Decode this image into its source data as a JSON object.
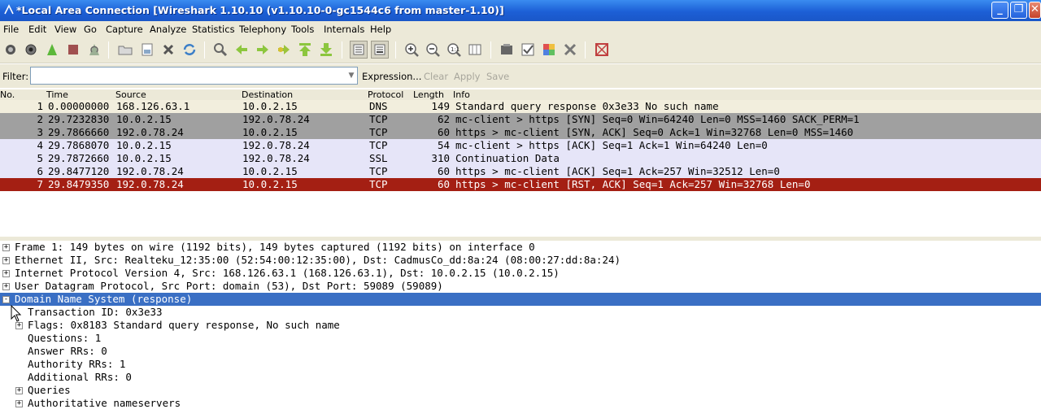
{
  "window": {
    "title": "*Local Area Connection   [Wireshark 1.10.10  (v1.10.10-0-gc1544c6 from master-1.10)]",
    "minimize_label": "_",
    "maximize_label": "❐",
    "close_label": "✕"
  },
  "menu": [
    "File",
    "Edit",
    "View",
    "Go",
    "Capture",
    "Analyze",
    "Statistics",
    "Telephony",
    "Tools",
    "Internals",
    "Help"
  ],
  "toolbar_icons": [
    "interfaces-icon",
    "options-icon",
    "start-capture-icon",
    "stop-capture-icon",
    "restart-capture-icon",
    "open-file-icon",
    "save-file-icon",
    "close-file-icon",
    "reload-icon",
    "find-packet-icon",
    "go-back-icon",
    "go-forward-icon",
    "go-to-packet-icon",
    "go-first-icon",
    "go-last-icon",
    "colorize-icon",
    "auto-scroll-icon",
    "zoom-in-icon",
    "zoom-out-icon",
    "normal-size-icon",
    "resize-columns-icon",
    "capture-filters-icon",
    "display-filters-icon",
    "coloring-rules-icon",
    "preferences-icon",
    "help-icon"
  ],
  "filter": {
    "label": "Filter:",
    "value": "",
    "expression_label": "Expression...",
    "clear_label": "Clear",
    "apply_label": "Apply",
    "save_label": "Save"
  },
  "packet_list": {
    "columns": [
      "No.",
      "Time",
      "Source",
      "Destination",
      "Protocol",
      "Length",
      "Info"
    ],
    "rows": [
      {
        "no": "1",
        "time": "0.00000000",
        "src": "168.126.63.1",
        "dst": "10.0.2.15",
        "proto": "DNS",
        "len": "149",
        "info": "Standard query response 0x3e33  No such name",
        "bg": "#f2eedd",
        "fg": "#000000"
      },
      {
        "no": "2",
        "time": "29.7232830",
        "src": "10.0.2.15",
        "dst": "192.0.78.24",
        "proto": "TCP",
        "len": "62",
        "info": "mc-client > https [SYN] Seq=0 Win=64240 Len=0 MSS=1460 SACK_PERM=1",
        "bg": "#a0a0a0",
        "fg": "#000000"
      },
      {
        "no": "3",
        "time": "29.7866660",
        "src": "192.0.78.24",
        "dst": "10.0.2.15",
        "proto": "TCP",
        "len": "60",
        "info": "https > mc-client [SYN, ACK] Seq=0 Ack=1 Win=32768 Len=0 MSS=1460",
        "bg": "#a0a0a0",
        "fg": "#000000"
      },
      {
        "no": "4",
        "time": "29.7868070",
        "src": "10.0.2.15",
        "dst": "192.0.78.24",
        "proto": "TCP",
        "len": "54",
        "info": "mc-client > https [ACK] Seq=1 Ack=1 Win=64240 Len=0",
        "bg": "#e6e5f8",
        "fg": "#000000"
      },
      {
        "no": "5",
        "time": "29.7872660",
        "src": "10.0.2.15",
        "dst": "192.0.78.24",
        "proto": "SSL",
        "len": "310",
        "info": "Continuation Data",
        "bg": "#e6e5f8",
        "fg": "#000000"
      },
      {
        "no": "6",
        "time": "29.8477120",
        "src": "192.0.78.24",
        "dst": "10.0.2.15",
        "proto": "TCP",
        "len": "60",
        "info": "https > mc-client [ACK] Seq=1 Ack=257 Win=32512 Len=0",
        "bg": "#e6e5f8",
        "fg": "#000000"
      },
      {
        "no": "7",
        "time": "29.8479350",
        "src": "192.0.78.24",
        "dst": "10.0.2.15",
        "proto": "TCP",
        "len": "60",
        "info": "https > mc-client [RST, ACK] Seq=1 Ack=257 Win=32768 Len=0",
        "bg": "#a41f13",
        "fg": "#ffffff"
      }
    ]
  },
  "details": [
    {
      "text": "Frame 1: 149 bytes on wire (1192 bits), 149 bytes captured (1192 bits) on interface 0",
      "level": 0,
      "expander": "+",
      "selected": false
    },
    {
      "text": "Ethernet II, Src: Realteku_12:35:00 (52:54:00:12:35:00), Dst: CadmusCo_dd:8a:24 (08:00:27:dd:8a:24)",
      "level": 0,
      "expander": "+",
      "selected": false
    },
    {
      "text": "Internet Protocol Version 4, Src: 168.126.63.1 (168.126.63.1), Dst: 10.0.2.15 (10.0.2.15)",
      "level": 0,
      "expander": "+",
      "selected": false
    },
    {
      "text": "User Datagram Protocol, Src Port: domain (53), Dst Port: 59089 (59089)",
      "level": 0,
      "expander": "+",
      "selected": false
    },
    {
      "text": "Domain Name System (response)",
      "level": 0,
      "expander": "-",
      "selected": true
    },
    {
      "text": "Transaction ID: 0x3e33",
      "level": 1,
      "expander": "",
      "selected": false
    },
    {
      "text": "Flags: 0x8183 Standard query response, No such name",
      "level": 1,
      "expander": "+",
      "selected": false
    },
    {
      "text": "Questions: 1",
      "level": 1,
      "expander": "",
      "selected": false
    },
    {
      "text": "Answer RRs: 0",
      "level": 1,
      "expander": "",
      "selected": false
    },
    {
      "text": "Authority RRs: 1",
      "level": 1,
      "expander": "",
      "selected": false
    },
    {
      "text": "Additional RRs: 0",
      "level": 1,
      "expander": "",
      "selected": false
    },
    {
      "text": "Queries",
      "level": 1,
      "expander": "+",
      "selected": false
    },
    {
      "text": "Authoritative nameservers",
      "level": 1,
      "expander": "+",
      "selected": false
    }
  ],
  "colors": {
    "selected_detail": "#3a6fc4",
    "titlebar": "#1c5fd6",
    "chrome": "#ece9d8"
  }
}
